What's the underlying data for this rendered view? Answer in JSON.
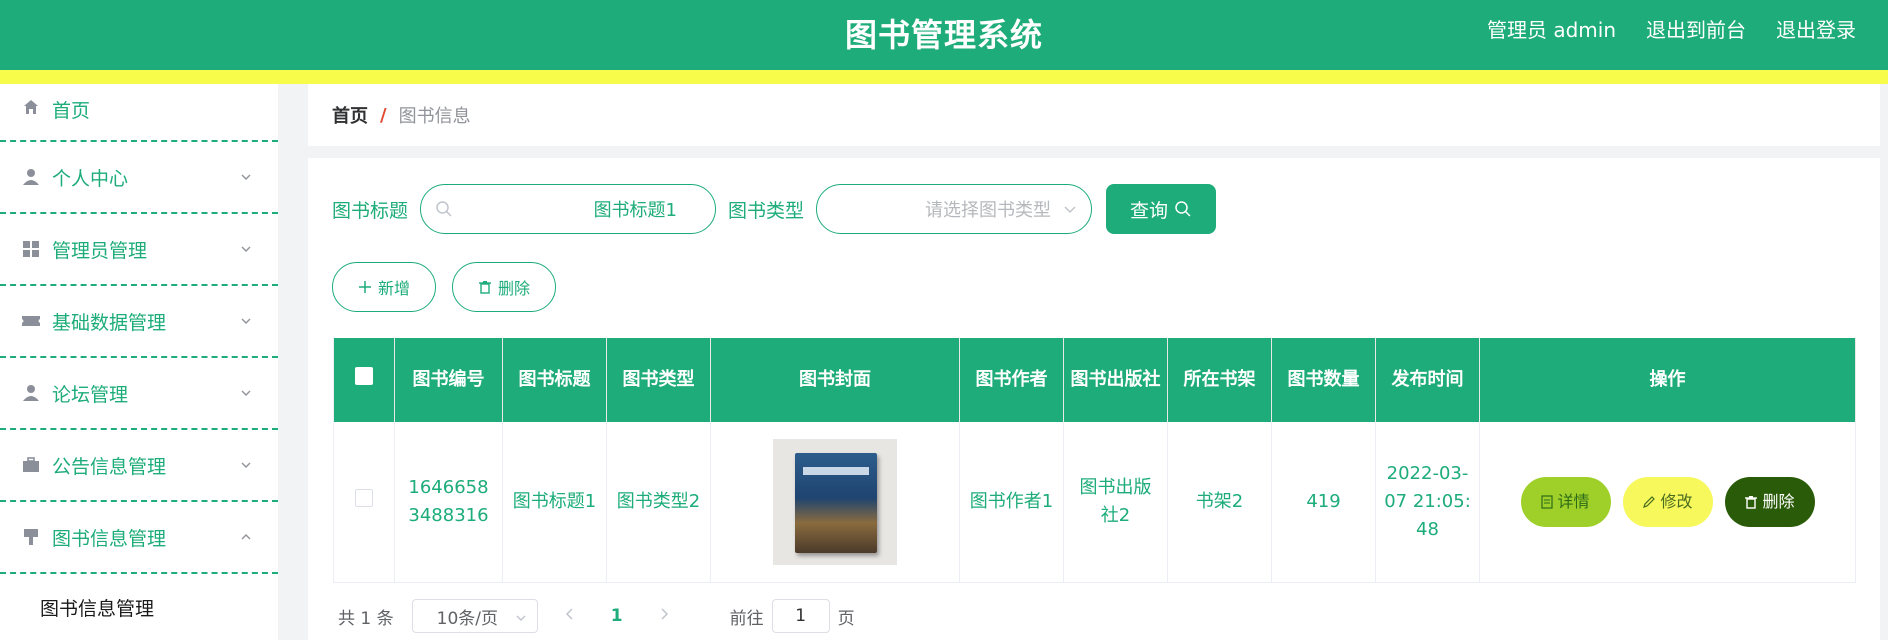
{
  "header": {
    "title": "图书管理系统",
    "admin_label": "管理员 admin",
    "to_front": "退出到前台",
    "logout": "退出登录"
  },
  "sidebar": {
    "items": [
      {
        "label": "首页",
        "icon": "home-icon"
      },
      {
        "label": "个人中心",
        "icon": "user-icon"
      },
      {
        "label": "管理员管理",
        "icon": "grid-icon"
      },
      {
        "label": "基础数据管理",
        "icon": "ticket-icon"
      },
      {
        "label": "论坛管理",
        "icon": "user-icon"
      },
      {
        "label": "公告信息管理",
        "icon": "briefcase-icon"
      },
      {
        "label": "图书信息管理",
        "icon": "brush-icon"
      }
    ],
    "submenu": "图书信息管理"
  },
  "breadcrumb": {
    "home": "首页",
    "separator": "/",
    "current": "图书信息"
  },
  "search": {
    "title_label": "图书标题",
    "title_value": "图书标题1",
    "type_label": "图书类型",
    "type_placeholder": "请选择图书类型",
    "query_button": "查询"
  },
  "actions": {
    "add": "新增",
    "delete": "删除"
  },
  "table": {
    "headers": [
      "图书编号",
      "图书标题",
      "图书类型",
      "图书封面",
      "图书作者",
      "图书出版社",
      "所在书架",
      "图书数量",
      "发布时间",
      "操作"
    ],
    "rows": [
      {
        "id": "16466583488316",
        "title": "图书标题1",
        "type": "图书类型2",
        "author": "图书作者1",
        "publisher": "图书出版社2",
        "shelf": "书架2",
        "quantity": "419",
        "time": "2022-03-07 21:05:48",
        "detail": "详情",
        "edit": "修改",
        "delete": "删除"
      }
    ]
  },
  "pagination": {
    "total": "共 1 条",
    "page_size": "10条/页",
    "current_page": "1",
    "goto_prefix": "前往",
    "goto_value": "1",
    "goto_suffix": "页"
  },
  "colors": {
    "primary": "#1dac7a",
    "stripe": "#f7fb4a",
    "detail": "#9fd02a",
    "edit": "#f6f85c",
    "delete": "#2a5b08"
  }
}
